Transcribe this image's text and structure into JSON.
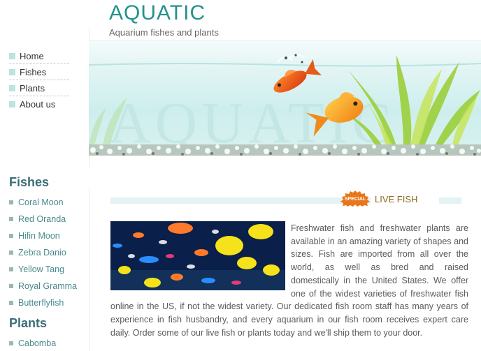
{
  "header": {
    "title": "AQUATIC",
    "subtitle": "Aquarium fishes and plants"
  },
  "nav": {
    "items": [
      {
        "label": "Home"
      },
      {
        "label": "Fishes"
      },
      {
        "label": "Plants"
      },
      {
        "label": "About us"
      }
    ]
  },
  "banner": {
    "watermark": "AQUATIC"
  },
  "sidebar": {
    "fishes_heading": "Fishes",
    "fishes": [
      "Coral Moon",
      "Red Oranda",
      "Hifin Moon",
      "Zebra Danio",
      "Yellow Tang",
      "Royal Gramma",
      "Butterflyfish"
    ],
    "plants_heading": "Plants",
    "plants": [
      "Cabomba"
    ]
  },
  "content": {
    "badge": "SPECIAL",
    "section_title": "LIVE FISH",
    "paragraph": "Freshwater fish and freshwater plants are available in an amazing variety of shapes and sizes. Fish are imported from all over the world, as well as bred and raised domestically in the United States. We offer one of the widest varieties of freshwater fish online in the US, if not the widest variety. Our dedicated fish room staff has many years of experience in fish husbandry, and every aquarium in our fish room receives expert care daily. Order some of our live fish or plants today and we'll ship them to your door."
  },
  "colors": {
    "brand": "#23928a",
    "sidebar_heading": "#3c6e78",
    "sidebar_link": "#4a8a8e",
    "section_title": "#8a6a18",
    "badge": "#e8761a"
  }
}
